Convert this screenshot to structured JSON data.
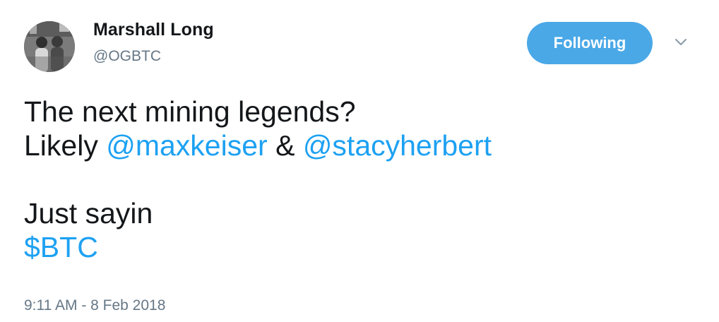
{
  "author": {
    "name": "Marshall Long",
    "handle": "@OGBTC",
    "avatar_icon": "profile-photo"
  },
  "actions": {
    "follow_label": "Following",
    "follow_color": "#4aa8e7",
    "menu_icon": "chevron-down-icon"
  },
  "tweet": {
    "line1": "The next mining legends?",
    "line2_prefix": "Likely ",
    "mention1": "@maxkeiser",
    "line2_middle": " & ",
    "mention2": "@stacyherbert",
    "line3": "Just sayin",
    "cashtag": "$BTC",
    "link_color": "#1da1f2"
  },
  "timestamp": "9:11 AM - 8 Feb 2018"
}
